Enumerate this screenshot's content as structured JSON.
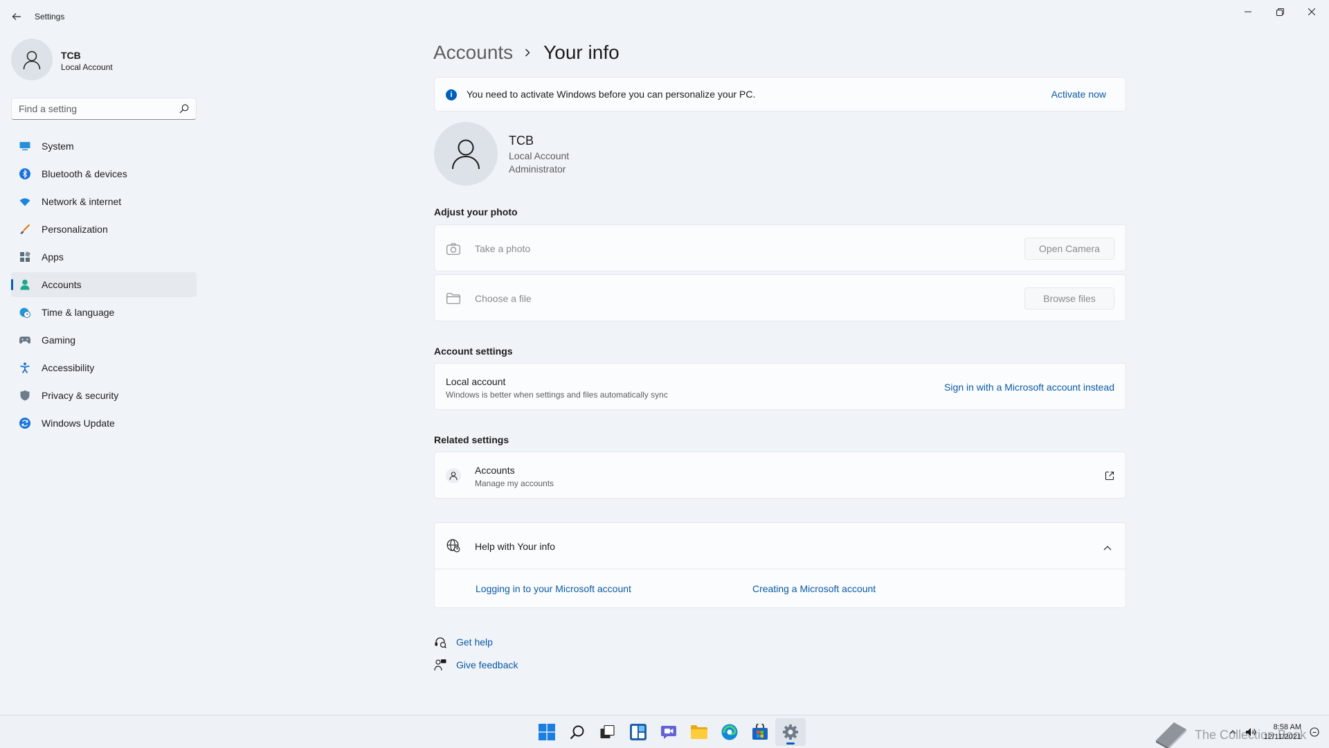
{
  "window": {
    "title": "Settings"
  },
  "profile": {
    "name": "TCB",
    "type": "Local Account"
  },
  "search": {
    "placeholder": "Find a setting"
  },
  "sidebar": {
    "items": [
      {
        "label": "System",
        "icon": "monitor-icon"
      },
      {
        "label": "Bluetooth & devices",
        "icon": "bluetooth-icon"
      },
      {
        "label": "Network & internet",
        "icon": "wifi-icon"
      },
      {
        "label": "Personalization",
        "icon": "brush-icon"
      },
      {
        "label": "Apps",
        "icon": "apps-icon"
      },
      {
        "label": "Accounts",
        "icon": "person-icon"
      },
      {
        "label": "Time & language",
        "icon": "globe-clock-icon"
      },
      {
        "label": "Gaming",
        "icon": "gamepad-icon"
      },
      {
        "label": "Accessibility",
        "icon": "accessibility-icon"
      },
      {
        "label": "Privacy & security",
        "icon": "shield-icon"
      },
      {
        "label": "Windows Update",
        "icon": "update-icon"
      }
    ],
    "active": "Accounts"
  },
  "breadcrumb": {
    "parent": "Accounts",
    "current": "Your info"
  },
  "banner": {
    "text": "You need to activate Windows before you can personalize your PC.",
    "link": "Activate now"
  },
  "user": {
    "name": "TCB",
    "account_type": "Local Account",
    "role": "Administrator"
  },
  "photo": {
    "title": "Adjust your photo",
    "take_label": "Take a photo",
    "take_button": "Open Camera",
    "choose_label": "Choose a file",
    "choose_button": "Browse files"
  },
  "account_settings": {
    "title": "Account settings",
    "row_title": "Local account",
    "row_desc": "Windows is better when settings and files automatically sync",
    "link": "Sign in with a Microsoft account instead"
  },
  "related": {
    "title": "Related settings",
    "row_title": "Accounts",
    "row_desc": "Manage my accounts"
  },
  "help": {
    "title": "Help with Your info",
    "links": [
      "Logging in to your Microsoft account",
      "Creating a Microsoft account"
    ]
  },
  "footer": {
    "get_help": "Get help",
    "give_feedback": "Give feedback"
  },
  "taskbar": {
    "apps": [
      "start-icon",
      "search-icon",
      "task-view-icon",
      "widgets-icon",
      "chat-icon",
      "file-explorer-icon",
      "edge-icon",
      "store-icon",
      "settings-icon"
    ],
    "time": "8:58 AM",
    "date": "12/11/2021",
    "watermark": "The Collection Book"
  },
  "colors": {
    "accent": "#005fb8",
    "link": "#0a5aa6",
    "background": "#f0f4f9"
  }
}
